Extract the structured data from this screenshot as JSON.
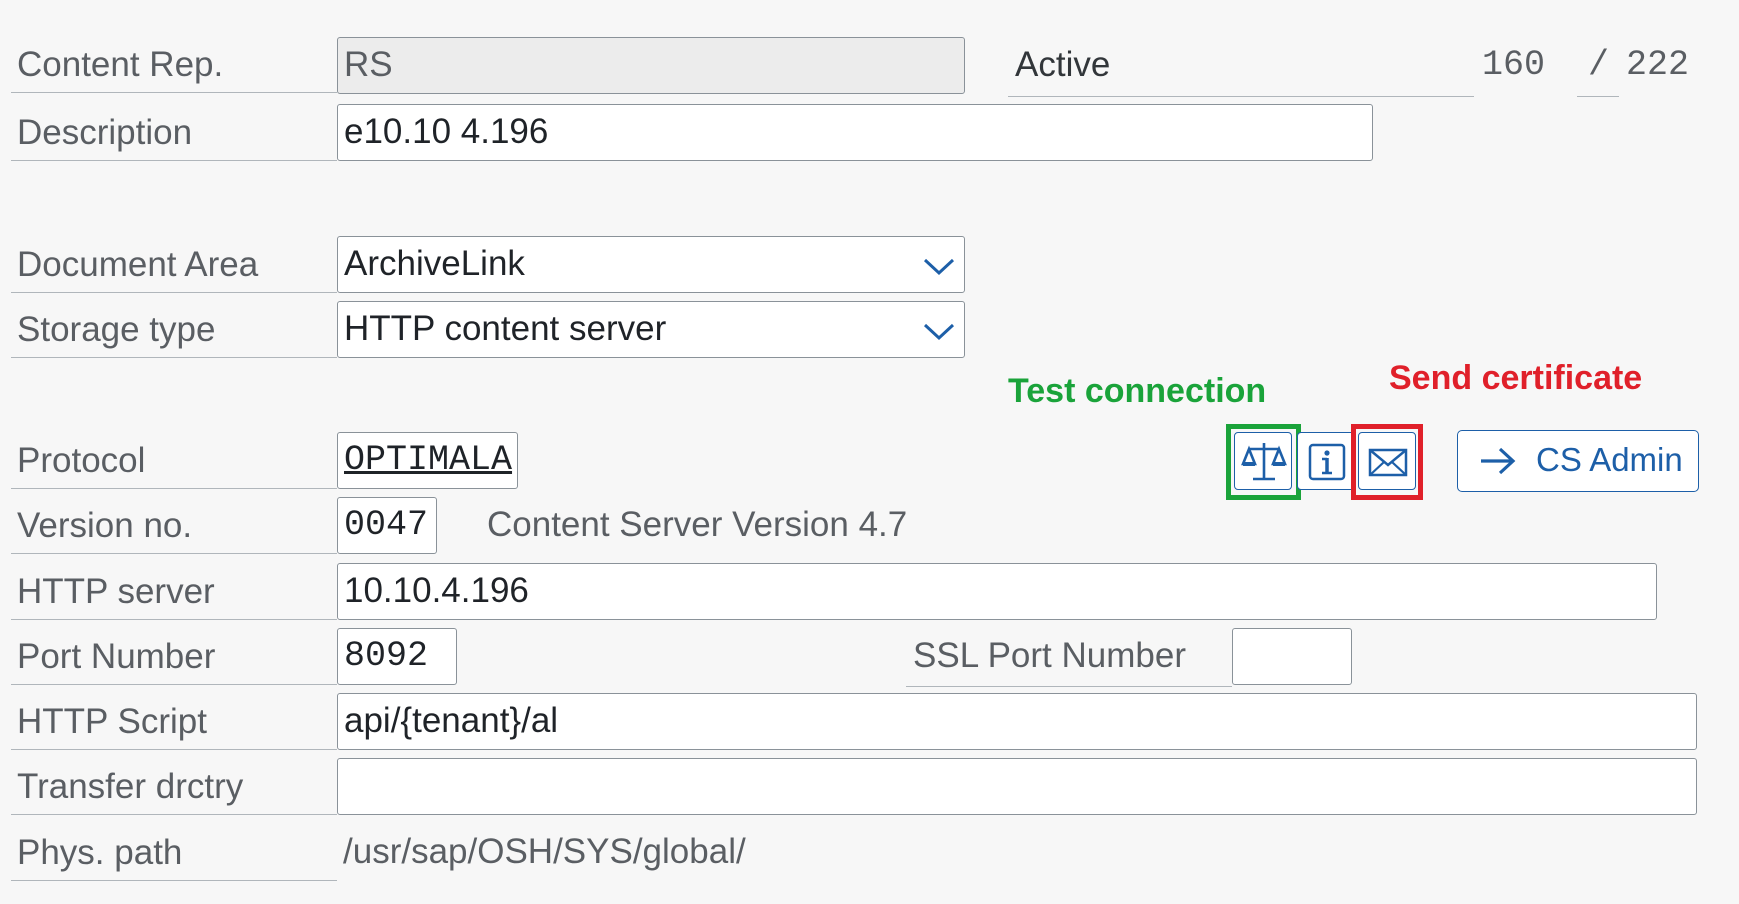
{
  "form": {
    "content_rep": {
      "label": "Content Rep.",
      "value": "RS"
    },
    "status": {
      "label": "Active",
      "current": "160",
      "separator": "/",
      "total": "222"
    },
    "description": {
      "label": "Description",
      "value": "e10.10 4.196"
    },
    "document_area": {
      "label": "Document Area",
      "value": "ArchiveLink"
    },
    "storage_type": {
      "label": "Storage type",
      "value": "HTTP content server"
    },
    "protocol": {
      "label": "Protocol",
      "value": "OPTIMALA"
    },
    "version_no": {
      "label": "Version no.",
      "value": "0047",
      "description": "Content Server Version 4.7"
    },
    "http_server": {
      "label": "HTTP server",
      "value": "10.10.4.196"
    },
    "port_number": {
      "label": "Port Number",
      "value": "8092"
    },
    "ssl_port_number": {
      "label": "SSL Port Number",
      "value": ""
    },
    "http_script": {
      "label": "HTTP Script",
      "value": "api/{tenant}/al"
    },
    "transfer_drctry": {
      "label": "Transfer drctry",
      "value": ""
    },
    "phys_path": {
      "label": "Phys. path",
      "value": "/usr/sap/OSH/SYS/global/"
    }
  },
  "toolbar": {
    "test_connection": {
      "icon": "balance-scale-icon"
    },
    "info": {
      "icon": "info-icon"
    },
    "send_certificate": {
      "icon": "envelope-icon"
    },
    "cs_admin": {
      "label": "CS Admin",
      "icon": "arrow-right-icon"
    }
  },
  "annotations": {
    "test_connection": {
      "text": "Test connection",
      "color": "#1aa33a"
    },
    "send_certificate": {
      "text": "Send certificate",
      "color": "#e0202a"
    }
  },
  "colors": {
    "accent": "#1d5fa8",
    "field_border": "#8a9299",
    "label": "#5a5e63"
  }
}
